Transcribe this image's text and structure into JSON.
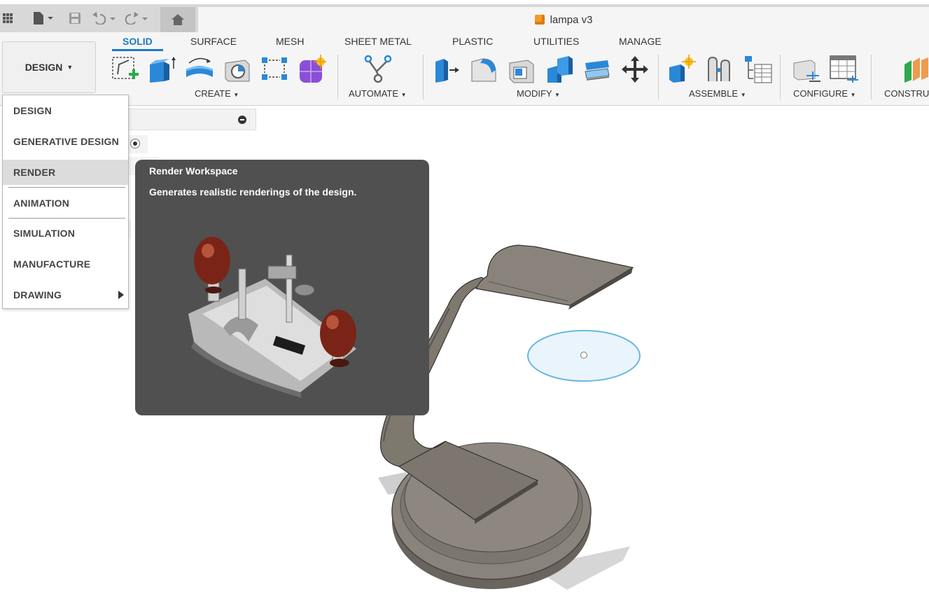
{
  "document": {
    "title": "lampa v3"
  },
  "workspace_button": {
    "label": "DESIGN"
  },
  "tabs": [
    {
      "label": "SOLID",
      "active": true
    },
    {
      "label": "SURFACE"
    },
    {
      "label": "MESH"
    },
    {
      "label": "SHEET METAL"
    },
    {
      "label": "PLASTIC"
    },
    {
      "label": "UTILITIES"
    },
    {
      "label": "MANAGE"
    }
  ],
  "groups": [
    {
      "label": "CREATE"
    },
    {
      "label": "AUTOMATE"
    },
    {
      "label": "MODIFY"
    },
    {
      "label": "ASSEMBLE"
    },
    {
      "label": "CONFIGURE"
    },
    {
      "label": "CONSTRU"
    }
  ],
  "workspace_menu": {
    "items": [
      {
        "label": "DESIGN"
      },
      {
        "label": "GENERATIVE DESIGN"
      },
      {
        "label": "RENDER",
        "highlighted": true
      },
      {
        "label": "ANIMATION"
      },
      {
        "label": "SIMULATION"
      },
      {
        "label": "MANUFACTURE"
      },
      {
        "label": "DRAWING",
        "has_submenu": true
      }
    ]
  },
  "tooltip": {
    "title": "Render Workspace",
    "description": "Generates realistic renderings of the design."
  },
  "colors": {
    "accent": "#1d7bbf",
    "tooltip_bg": "#505050",
    "model": "#7a746c",
    "sketch_circle": "#6ab7de"
  }
}
